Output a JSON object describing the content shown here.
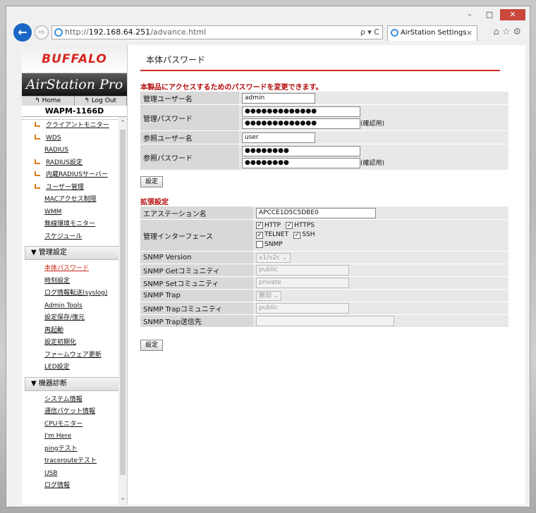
{
  "browser": {
    "url_protocol": "http://",
    "url_host": "192.168.64.251",
    "url_path": "/advance.html",
    "url_controls": "ρ ▾ C",
    "tab_title": "AirStation Settings",
    "tab_close": "×",
    "minimize": "–",
    "maximize": "□",
    "close": "✕",
    "back": "←",
    "forward": "⇨",
    "tools": "⌂☆⚙"
  },
  "sidebar": {
    "brand": "BUFFALO",
    "product": "AirStation Pro",
    "home": "↰ Home",
    "logout": "↰ Log Out",
    "model": "WAPM-1166D",
    "scroll_up": "⌃",
    "scroll_down": "⌄",
    "items1": [
      {
        "label": "クライアントモニター",
        "sub": true
      },
      {
        "label": "WDS",
        "sub": true
      },
      {
        "label": "RADIUS",
        "sub": false
      },
      {
        "label": "RADIUS設定",
        "sub": true
      },
      {
        "label": "内蔵RADIUSサーバー",
        "sub": true
      },
      {
        "label": "ユーザー管理",
        "sub": true
      },
      {
        "label": "MACアクセス制限",
        "sub": false
      },
      {
        "label": "WMM",
        "sub": false
      },
      {
        "label": "無線環境モニター",
        "sub": false
      },
      {
        "label": "スケジュール",
        "sub": false
      }
    ],
    "section_admin": "▼ 管理設定",
    "items2": [
      "本体パスワード",
      "時刻設定",
      "ログ情報転送(syslog)",
      "Admin Tools",
      "設定保存/復元",
      "再起動",
      "設定初期化",
      "ファームウェア更新",
      "LED設定"
    ],
    "section_diag": "▼ 機器診断",
    "items3": [
      "システム情報",
      "通信パケット情報",
      "CPUモニター",
      "I'm Here",
      "pingテスト",
      "tracerouteテスト",
      "USB",
      "ログ情報"
    ]
  },
  "main": {
    "title": "本体パスワード",
    "note": "本製品にアクセスするためのパスワードを変更できます。",
    "admin_user_label": "管理ユーザー名",
    "admin_user": "admin",
    "admin_pass_label": "管理パスワード",
    "admin_pass": "●●●●●●●●●●●●●",
    "admin_pass_confirm": "●●●●●●●●●●●●●",
    "confirm_label": "(確認用)",
    "ref_user_label": "参照ユーザー名",
    "ref_user": "user",
    "ref_pass_label": "参照パスワード",
    "ref_pass": "●●●●●●●●",
    "ref_pass_confirm": "●●●●●●●●",
    "set_button": "設定",
    "ext_title": "拡張設定",
    "airstation_name_label": "エアステーション名",
    "airstation_name": "APCCE1D5C5DBE0",
    "mgmt_if_label": "管理インターフェース",
    "if_http": "HTTP",
    "if_https": "HTTPS",
    "if_telnet": "TELNET",
    "if_ssh": "SSH",
    "if_snmp": "SNMP",
    "snmp_version_label": "SNMP Version",
    "snmp_version": "v1/v2c",
    "snmp_get_label": "SNMP Getコミュニティ",
    "snmp_get": "public",
    "snmp_set_label": "SNMP Setコミュニティ",
    "snmp_set": "private",
    "snmp_trap_label": "SNMP Trap",
    "snmp_trap": "無効",
    "snmp_trap_comm_label": "SNMP Trapコミュニティ",
    "snmp_trap_comm": "public",
    "snmp_trap_dest_label": "SNMP Trap送信先",
    "snmp_trap_dest": "",
    "check": "✓",
    "caret": "⌄"
  }
}
